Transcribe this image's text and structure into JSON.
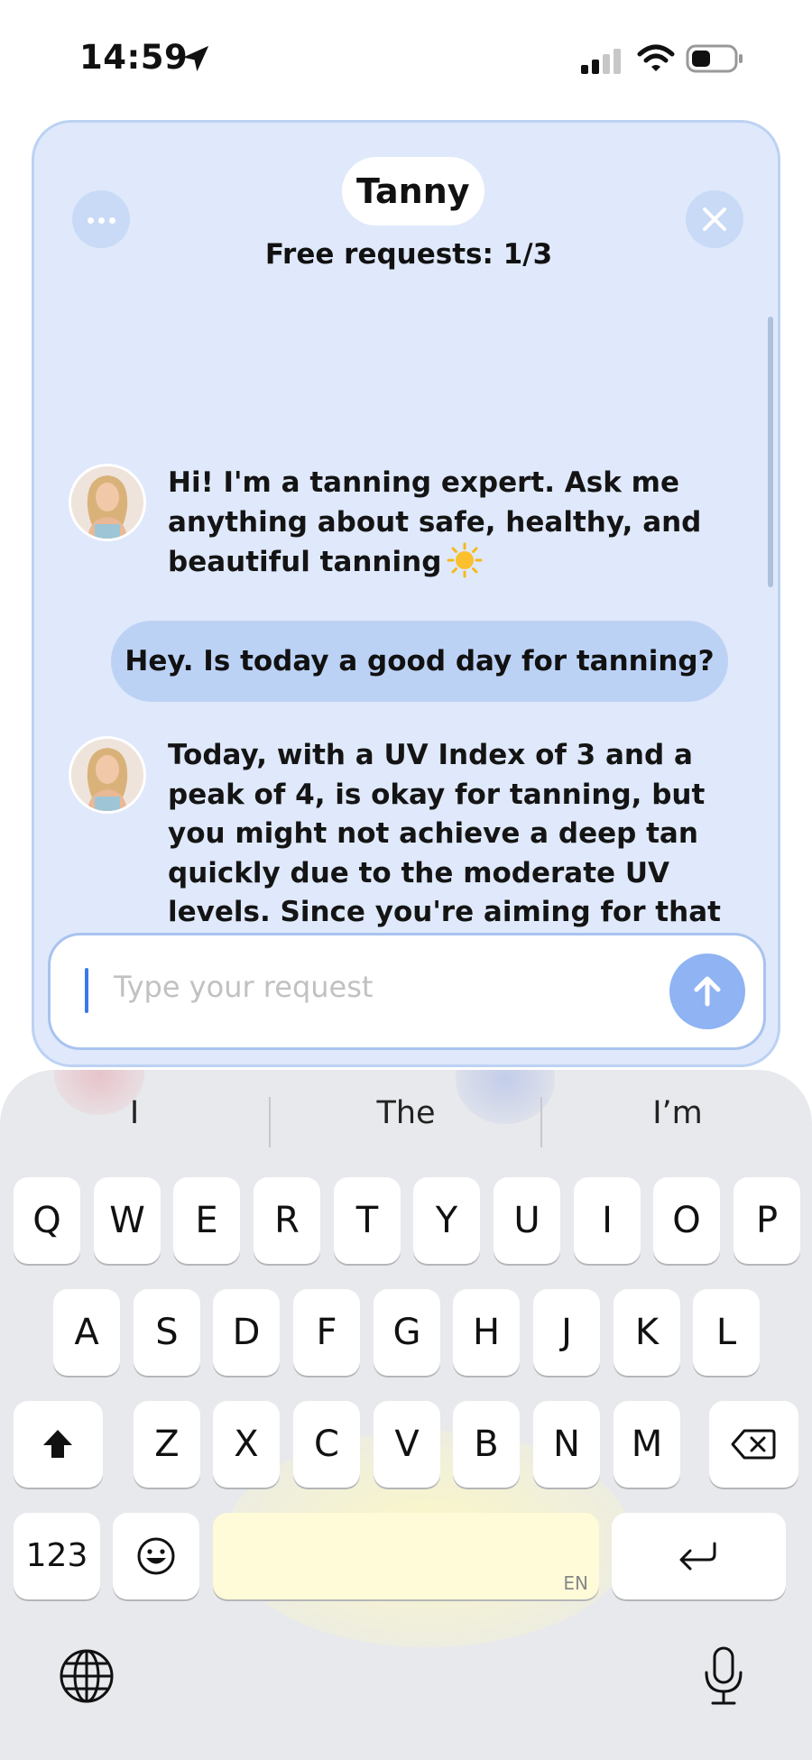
{
  "status_bar": {
    "time": "14:59",
    "icons": [
      "location-arrow-icon",
      "cellular-signal-icon",
      "wifi-icon",
      "battery-icon"
    ]
  },
  "chat": {
    "title": "Tanny",
    "free_requests": "Free requests: 1/3",
    "messages": [
      {
        "sender": "bot",
        "text": "Hi! I'm a tanning expert. Ask me anything about safe, healthy, and beautiful tanning"
      },
      {
        "sender": "user",
        "text": "Hey. Is today a good day for tanning?"
      },
      {
        "sender": "bot",
        "text": "Today, with a UV Index of 3 and a peak of 4, is okay for tanning, but you might not achieve a deep tan quickly due to the moderate UV levels. Since you're aiming for that \"Caramel\" shade, spending some time in the sun with these UV levels is a good start, but I'll emphasize safety."
      }
    ],
    "input_placeholder": "Type your request",
    "accent_color": "#8fb3f3"
  },
  "keyboard": {
    "suggestions": [
      "I",
      "The",
      "I’m"
    ],
    "row1": [
      "Q",
      "W",
      "E",
      "R",
      "T",
      "Y",
      "U",
      "I",
      "O",
      "P"
    ],
    "row2": [
      "A",
      "S",
      "D",
      "F",
      "G",
      "H",
      "J",
      "K",
      "L"
    ],
    "row3": [
      "Z",
      "X",
      "C",
      "V",
      "B",
      "N",
      "M"
    ],
    "numbers_label": "123",
    "space_lang": "EN"
  }
}
